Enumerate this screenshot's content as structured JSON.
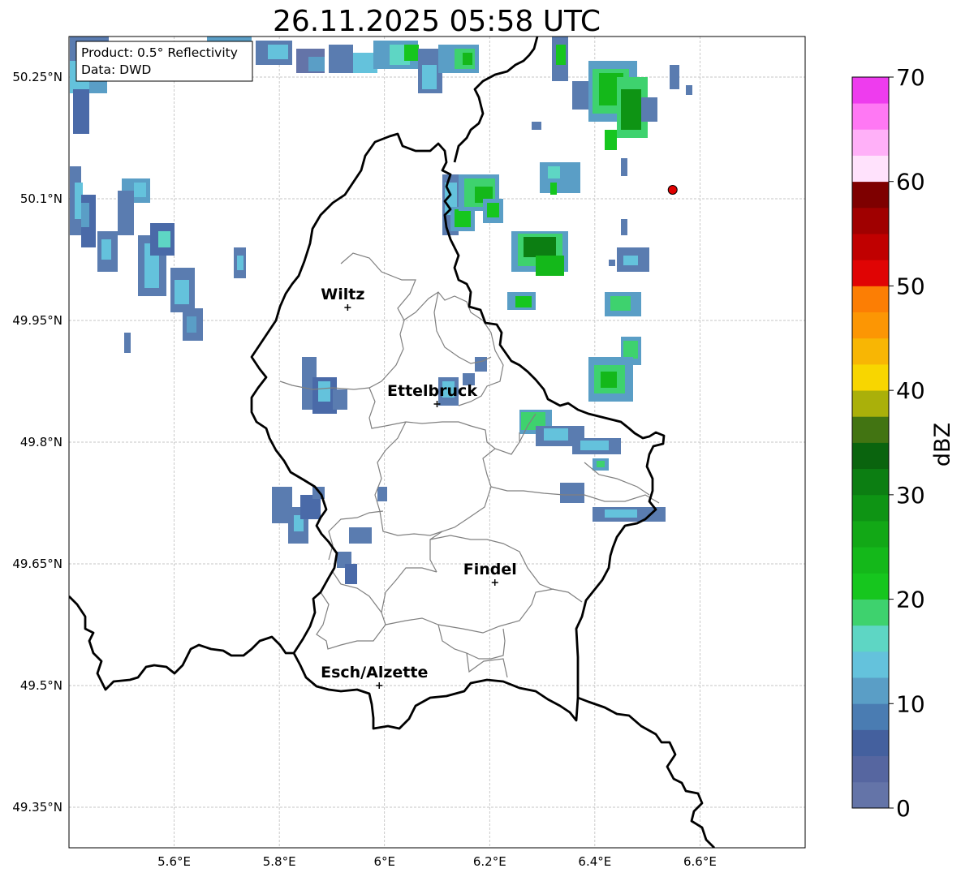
{
  "title": "26.11.2025 05:58 UTC",
  "info_box": {
    "product": "Product: 0.5° Reflectivity",
    "source": "Data: DWD"
  },
  "map": {
    "lon_range": [
      5.4,
      6.8
    ],
    "lat_range": [
      49.3,
      50.3
    ],
    "lon_ticks": [
      {
        "value": 5.6,
        "label": "5.6°E"
      },
      {
        "value": 5.8,
        "label": "5.8°E"
      },
      {
        "value": 6.0,
        "label": "6°E"
      },
      {
        "value": 6.2,
        "label": "6.2°E"
      },
      {
        "value": 6.4,
        "label": "6.4°E"
      },
      {
        "value": 6.6,
        "label": "6.6°E"
      }
    ],
    "lat_ticks": [
      {
        "value": 50.25,
        "label": "50.25°N"
      },
      {
        "value": 50.1,
        "label": "50.1°N"
      },
      {
        "value": 49.95,
        "label": "49.95°N"
      },
      {
        "value": 49.8,
        "label": "49.8°N"
      },
      {
        "value": 49.65,
        "label": "49.65°N"
      },
      {
        "value": 49.5,
        "label": "49.5°N"
      },
      {
        "value": 49.35,
        "label": "49.35°N"
      }
    ],
    "cities": [
      {
        "name": "Wiltz",
        "lon": 5.93,
        "lat": 49.966
      },
      {
        "name": "Ettelbruck",
        "lon": 6.1,
        "lat": 49.847
      },
      {
        "name": "Findel",
        "lon": 6.21,
        "lat": 49.627
      },
      {
        "name": "Esch/Alzette",
        "lon": 5.99,
        "lat": 49.5
      }
    ],
    "radar_site": {
      "lon": 6.548,
      "lat": 50.111,
      "color": "#e00000"
    }
  },
  "colorbar": {
    "label": "dBZ",
    "min": 0,
    "max": 70,
    "step": 2.5,
    "tick_labels": [
      "0",
      "10",
      "20",
      "30",
      "40",
      "50",
      "60",
      "70"
    ],
    "colors": [
      "#6474a8",
      "#5666a0",
      "#44609e",
      "#4a7cb2",
      "#5a9ec6",
      "#64c2dc",
      "#5ed6c4",
      "#3ed26e",
      "#16c61e",
      "#14b81a",
      "#12a816",
      "#0e9414",
      "#0c7e12",
      "#0a640e",
      "#427412",
      "#aab00a",
      "#f8d600",
      "#f8b604",
      "#fc9604",
      "#fc7e04",
      "#e00404",
      "#c00000",
      "#a00000",
      "#7e0000",
      "#ffe2fc",
      "#ffb0f8",
      "#ff78f4",
      "#ee3cee"
    ]
  }
}
